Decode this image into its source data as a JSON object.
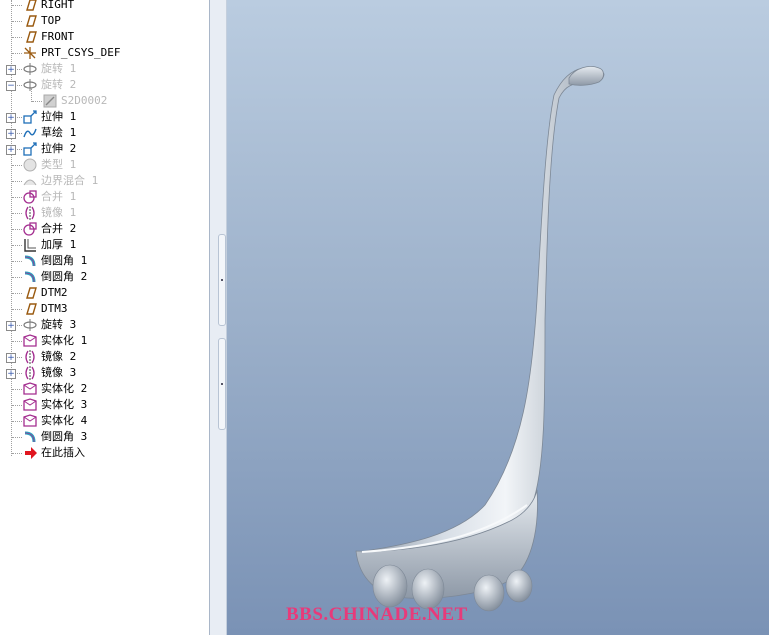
{
  "model_tree": {
    "items": [
      {
        "label": "RIGHT",
        "icon": "datum-plane-icon"
      },
      {
        "label": "TOP",
        "icon": "datum-plane-icon"
      },
      {
        "label": "FRONT",
        "icon": "datum-plane-icon"
      },
      {
        "label": "PRT_CSYS_DEF",
        "icon": "coordinate-system-icon"
      },
      {
        "label": "旋转 1",
        "icon": "revolve-icon",
        "suppressed": true,
        "expander": "+"
      },
      {
        "label": "旋转 2",
        "icon": "revolve-icon",
        "suppressed": true,
        "expander": "−"
      },
      {
        "label": "S2D0002",
        "icon": "sketch-section-icon",
        "suppressed": true,
        "child": true
      },
      {
        "label": "拉伸 1",
        "icon": "extrude-icon",
        "expander": "+"
      },
      {
        "label": "草绘 1",
        "icon": "sketch-icon",
        "expander": "+"
      },
      {
        "label": "拉伸 2",
        "icon": "extrude-icon",
        "expander": "+"
      },
      {
        "label": "类型 1",
        "icon": "style-icon",
        "suppressed": true
      },
      {
        "label": "边界混合 1",
        "icon": "boundary-blend-icon",
        "suppressed": true
      },
      {
        "label": "合并 1",
        "icon": "merge-icon",
        "suppressed": true
      },
      {
        "label": "镜像 1",
        "icon": "mirror-icon",
        "suppressed": true
      },
      {
        "label": "合并 2",
        "icon": "merge-icon"
      },
      {
        "label": "加厚 1",
        "icon": "thicken-icon"
      },
      {
        "label": "倒圆角 1",
        "icon": "round-icon"
      },
      {
        "label": "倒圆角 2",
        "icon": "round-icon"
      },
      {
        "label": "DTM2",
        "icon": "datum-plane-icon"
      },
      {
        "label": "DTM3",
        "icon": "datum-plane-icon"
      },
      {
        "label": "旋转 3",
        "icon": "revolve-icon",
        "expander": "+"
      },
      {
        "label": "实体化 1",
        "icon": "solidify-icon"
      },
      {
        "label": "镜像 2",
        "icon": "mirror-icon",
        "expander": "+"
      },
      {
        "label": "镜像 3",
        "icon": "mirror-icon",
        "expander": "+"
      },
      {
        "label": "实体化 2",
        "icon": "solidify-icon"
      },
      {
        "label": "实体化 3",
        "icon": "solidify-icon"
      },
      {
        "label": "实体化 4",
        "icon": "solidify-icon"
      },
      {
        "label": "倒圆角 3",
        "icon": "round-icon"
      },
      {
        "label": "在此插入",
        "icon": "insert-here-arrow-icon"
      }
    ]
  },
  "viewport": {
    "model": "ladle-part-3d",
    "watermark": "BBS.CHINADE.NET",
    "colors": {
      "background_top": "#bacce0",
      "background_bottom": "#7a92b5",
      "watermark": "#e83a7a",
      "model": "#c9d2dc"
    }
  }
}
